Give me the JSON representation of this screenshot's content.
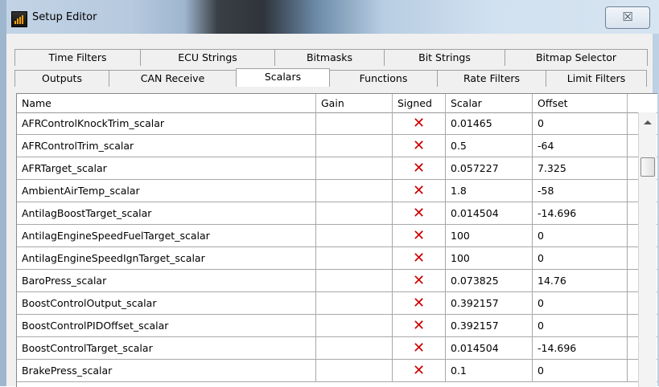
{
  "window": {
    "title": "Setup Editor",
    "close_glyph": "☒"
  },
  "tabs_top": [
    {
      "label": "Time Filters"
    },
    {
      "label": "ECU Strings"
    },
    {
      "label": "Bitmasks"
    },
    {
      "label": "Bit Strings"
    },
    {
      "label": "Bitmap Selector"
    }
  ],
  "tabs_bottom": [
    {
      "label": "Outputs"
    },
    {
      "label": "CAN Receive"
    },
    {
      "label": "Scalars",
      "active": true
    },
    {
      "label": "Functions"
    },
    {
      "label": "Rate Filters"
    },
    {
      "label": "Limit Filters"
    }
  ],
  "table": {
    "columns": [
      "Name",
      "Gain",
      "Signed",
      "Scalar",
      "Offset"
    ],
    "signed_color": "#cc0000",
    "rows": [
      {
        "name": "AFRControlKnockTrim_scalar",
        "gain": "",
        "signed": "✕",
        "scalar": "0.01465",
        "offset": "0"
      },
      {
        "name": "AFRControlTrim_scalar",
        "gain": "",
        "signed": "✕",
        "scalar": "0.5",
        "offset": "-64"
      },
      {
        "name": "AFRTarget_scalar",
        "gain": "",
        "signed": "✕",
        "scalar": "0.057227",
        "offset": "7.325"
      },
      {
        "name": "AmbientAirTemp_scalar",
        "gain": "",
        "signed": "✕",
        "scalar": "1.8",
        "offset": "-58"
      },
      {
        "name": "AntilagBoostTarget_scalar",
        "gain": "",
        "signed": "✕",
        "scalar": "0.014504",
        "offset": "-14.696"
      },
      {
        "name": "AntilagEngineSpeedFuelTarget_scalar",
        "gain": "",
        "signed": "✕",
        "scalar": "100",
        "offset": "0"
      },
      {
        "name": "AntilagEngineSpeedIgnTarget_scalar",
        "gain": "",
        "signed": "✕",
        "scalar": "100",
        "offset": "0"
      },
      {
        "name": "BaroPress_scalar",
        "gain": "",
        "signed": "✕",
        "scalar": "0.073825",
        "offset": "14.76"
      },
      {
        "name": "BoostControlOutput_scalar",
        "gain": "",
        "signed": "✕",
        "scalar": "0.392157",
        "offset": "0"
      },
      {
        "name": "BoostControlPIDOffset_scalar",
        "gain": "",
        "signed": "✕",
        "scalar": "0.392157",
        "offset": "0"
      },
      {
        "name": "BoostControlTarget_scalar",
        "gain": "",
        "signed": "✕",
        "scalar": "0.014504",
        "offset": "-14.696"
      },
      {
        "name": "BrakePress_scalar",
        "gain": "",
        "signed": "✕",
        "scalar": "0.1",
        "offset": "0"
      }
    ]
  }
}
